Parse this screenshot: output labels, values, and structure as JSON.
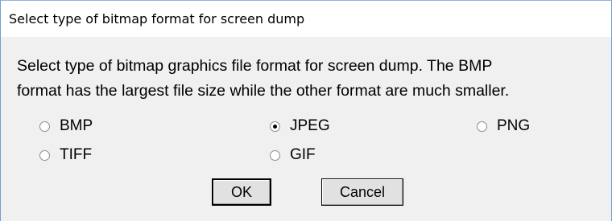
{
  "dialog": {
    "title": "Select type of bitmap format for screen dump",
    "message_line1": "Select type of bitmap graphics file format for screen dump. The BMP",
    "message_line2": "format has the largest file size while the other format are much smaller.",
    "options": [
      {
        "label": "BMP",
        "selected": false
      },
      {
        "label": "JPEG",
        "selected": true
      },
      {
        "label": "PNG",
        "selected": false
      },
      {
        "label": "TIFF",
        "selected": false
      },
      {
        "label": "GIF",
        "selected": false
      }
    ],
    "selected_format": "JPEG",
    "ok_label": "OK",
    "cancel_label": "Cancel"
  },
  "colors": {
    "title_bg": "#ffffff",
    "client_bg": "#f0f0f0",
    "border": "#6d9fd1"
  }
}
